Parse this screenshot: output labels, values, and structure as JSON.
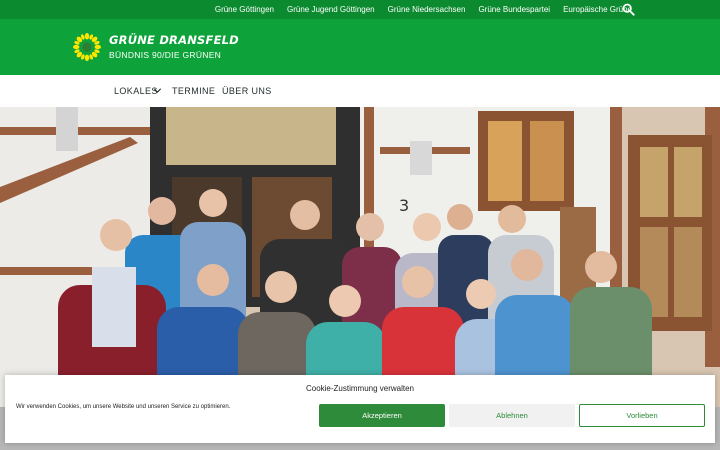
{
  "topbar": {
    "links": [
      "Grüne Göttingen",
      "Grüne Jugend Göttingen",
      "Grüne Niedersachsen",
      "Grüne Bundespartei",
      "Europäische Grüne"
    ],
    "search_icon": "search-icon"
  },
  "header": {
    "logo_icon": "sunflower-icon",
    "title": "GRÜNE DRANSFELD",
    "subtitle": "BÜNDNIS 90/DIE GRÜNEN"
  },
  "nav": {
    "items": [
      "LOKALES",
      "TERMINE",
      "ÜBER UNS"
    ],
    "dropdown_icon": "chevron-down-icon"
  },
  "hero": {
    "house_number": "3"
  },
  "cookie_banner": {
    "title": "Cookie-Zustimmung verwalten",
    "text": "Wir verwenden Cookies, um unsere Website und unseren Service zu optimieren.",
    "accept_label": "Akzeptieren",
    "deny_label": "Ablehnen",
    "preferences_label": "Vorlieben"
  },
  "colors": {
    "topbar_green": "#0b8a2f",
    "header_green": "#0ea33a",
    "button_green": "#2e8b3a",
    "sunflower_yellow": "#ffe600"
  }
}
